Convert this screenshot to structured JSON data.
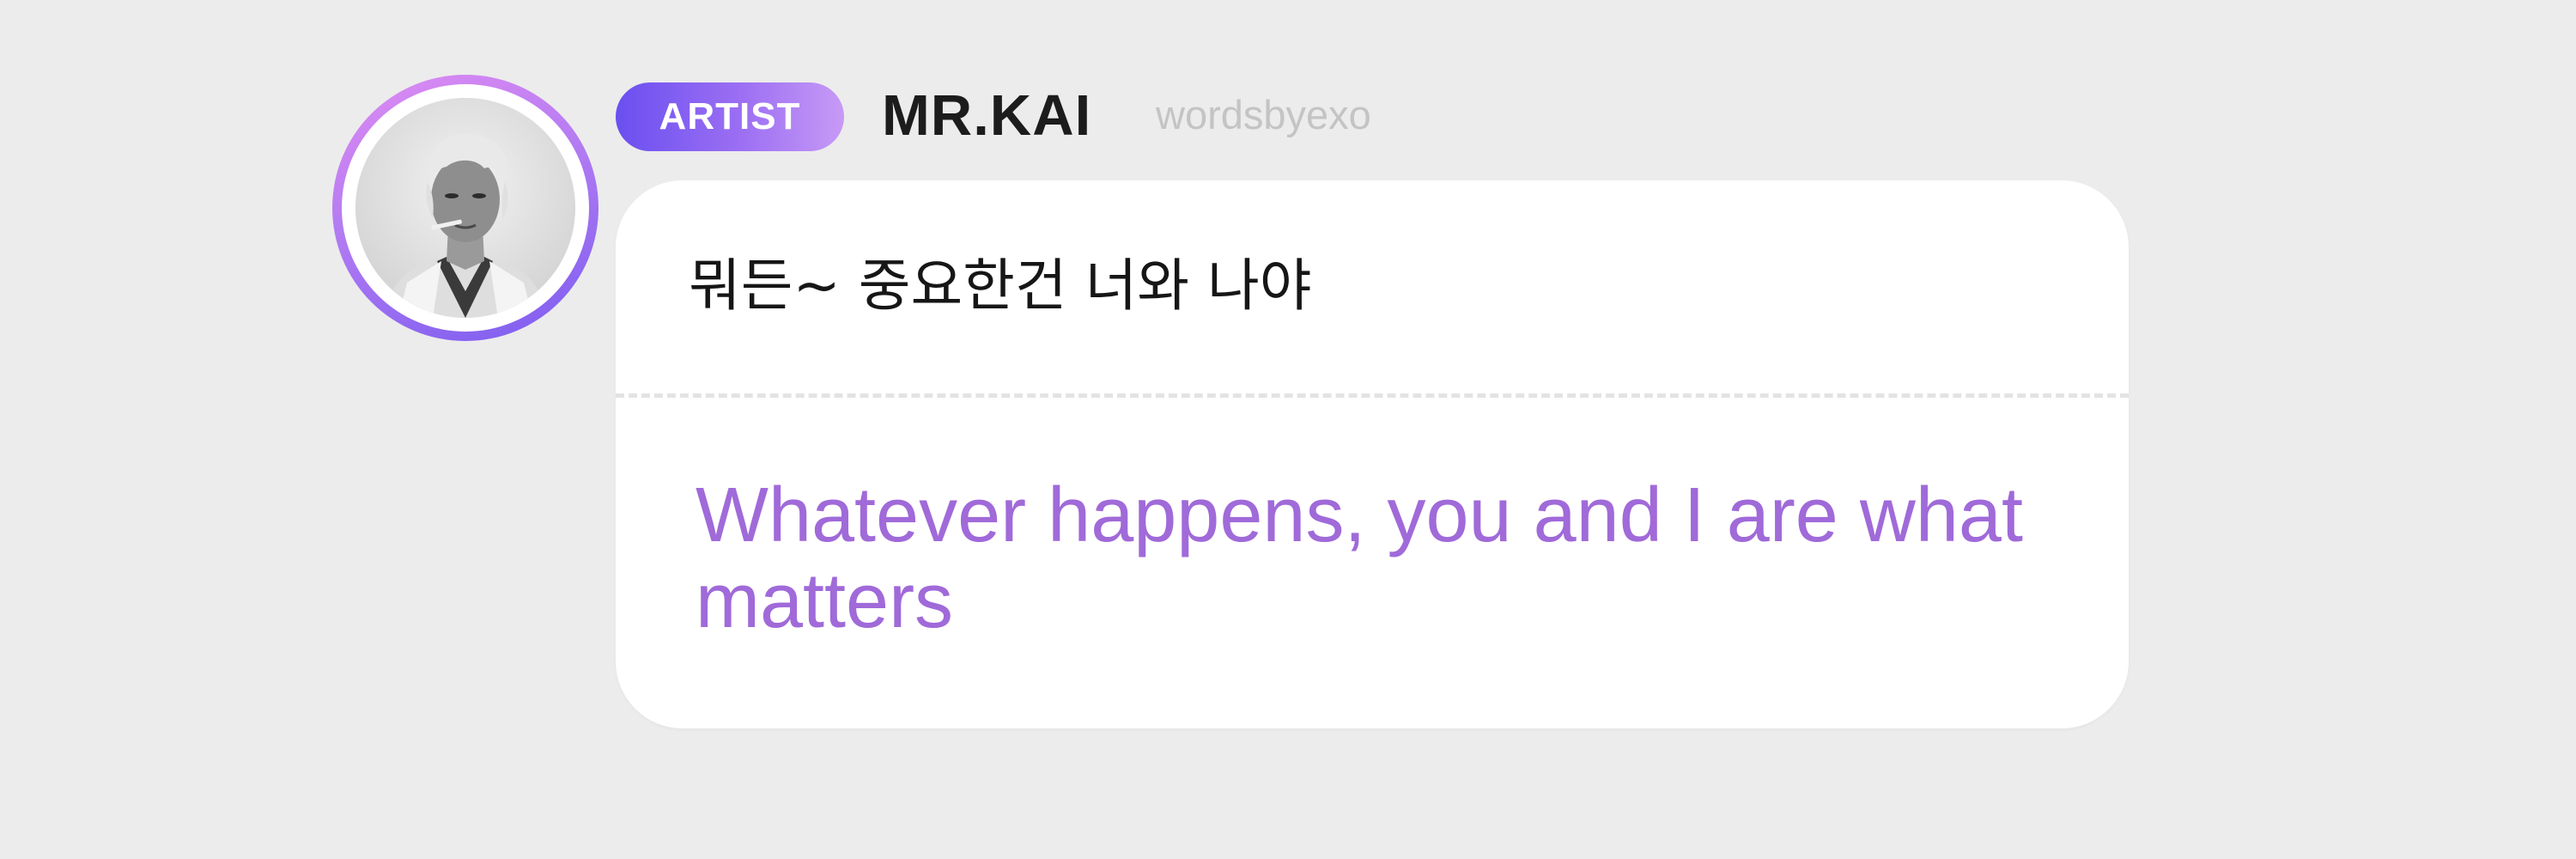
{
  "post": {
    "badge_label": "ARTIST",
    "display_name": "MR.KAI",
    "username": "wordsbyexo",
    "original_text": "뭐든~ 중요한건 너와 나야",
    "translation_text": "Whatever happens, you and I are what matters"
  },
  "colors": {
    "background": "#ececec",
    "badge_gradient_start": "#6a4ff0",
    "badge_gradient_end": "#c79af6",
    "translation_text": "#a06ad9",
    "username_text": "#c4c4c4",
    "card_background": "#ffffff"
  },
  "icons": {
    "avatar": "artist-profile-photo"
  }
}
